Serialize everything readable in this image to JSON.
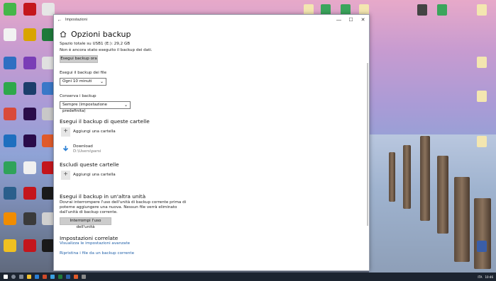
{
  "window": {
    "title": "Impostazioni",
    "back_glyph": "←",
    "minimize_glyph": "—",
    "maximize_glyph": "☐",
    "close_glyph": "✕"
  },
  "page": {
    "title": "Opzioni backup",
    "total_space": "Spazio totale su USB1 (E:): 29,2 GB",
    "no_backup_yet": "Non è ancora stato eseguito il backup dei dati.",
    "backup_now_button": "Esegui backup ora",
    "backup_frequency_label": "Esegui il backup dei file",
    "backup_frequency_value": "Ogni 10 minuti",
    "keep_backups_label": "Conserva i backup",
    "keep_backups_value": "Sempre (impostazione predefinita)",
    "dropdown_chevron": "⌄"
  },
  "include_folders": {
    "heading": "Esegui il backup di queste cartelle",
    "add_label": "Aggiungi una cartella",
    "folders": [
      {
        "name": "Download",
        "path": "D:\\Users\\parsi"
      }
    ]
  },
  "exclude_folders": {
    "heading": "Escludi queste cartelle",
    "add_label": "Aggiungi una cartella"
  },
  "other_drive": {
    "heading": "Esegui il backup in un'altra unità",
    "desc_line1": "Dovrai interrompere l'uso dell'unità di backup corrente prima di",
    "desc_line2": "poterne aggiungere una nuova. Nessun file verrà eliminato",
    "desc_line3": "dall'unità di backup corrente.",
    "stop_button": "Interrompi l'uso dell'unità"
  },
  "related": {
    "heading": "Impostazioni correlate",
    "advanced_link": "Visualizza le impostazioni avanzate",
    "restore_link": "Ripristina i file da un backup corrente"
  },
  "taskbar": {
    "time": "10:46",
    "lang": "ITA"
  },
  "colors": {
    "link": "#1f5fa8",
    "download_icon": "#2a7fd4"
  }
}
